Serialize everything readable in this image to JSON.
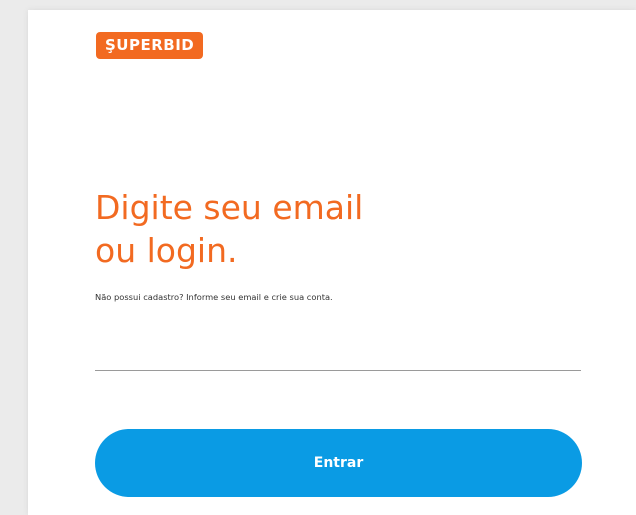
{
  "brand": {
    "logo_text": "ŞUPERBID",
    "logo_color": "#f26a21"
  },
  "login": {
    "title_line1": "Digite seu email",
    "title_line2": "ou login.",
    "subtitle": "Não possui cadastro? Informe seu email e crie sua conta.",
    "email_value": "",
    "email_placeholder": "",
    "submit_label": "Entrar"
  },
  "colors": {
    "accent": "#f26a21",
    "button": "#0a9be4",
    "text": "#333333",
    "background": "#ffffff"
  }
}
